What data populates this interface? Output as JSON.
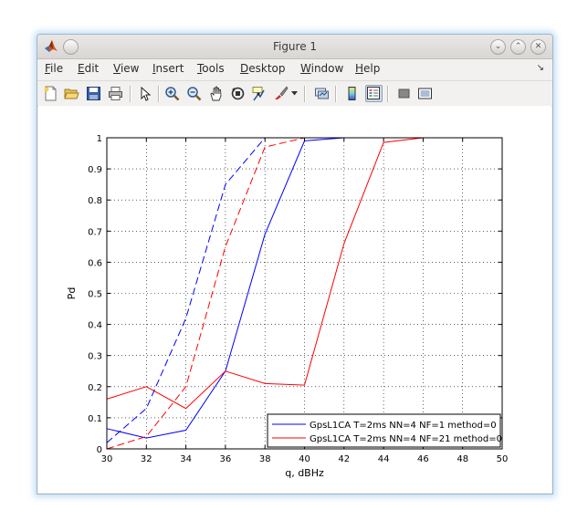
{
  "window": {
    "title": "Figure 1",
    "buttons": {
      "minimize": "⌄",
      "maximize": "⌃",
      "close": "✕"
    }
  },
  "menubar": {
    "items": [
      {
        "label": "File",
        "mnemonic": "F",
        "rest": "ile"
      },
      {
        "label": "Edit",
        "mnemonic": "E",
        "rest": "dit"
      },
      {
        "label": "View",
        "mnemonic": "V",
        "rest": "iew"
      },
      {
        "label": "Insert",
        "mnemonic": "I",
        "rest": "nsert"
      },
      {
        "label": "Tools",
        "mnemonic": "T",
        "rest": "ools"
      },
      {
        "label": "Desktop",
        "mnemonic": "D",
        "rest": "esktop"
      },
      {
        "label": "Window",
        "mnemonic": "W",
        "rest": "indow"
      },
      {
        "label": "Help",
        "mnemonic": "H",
        "rest": "elp"
      }
    ],
    "overflow_icon": "↘"
  },
  "toolbar": {
    "icons": [
      "new-figure-icon",
      "open-file-icon",
      "save-icon",
      "print-icon",
      "pointer-icon",
      "zoom-in-icon",
      "zoom-out-icon",
      "pan-icon",
      "rotate-3d-icon",
      "data-cursor-icon",
      "brush-icon",
      "link-plot-icon",
      "colorbar-icon",
      "legend-icon",
      "hide-plot-tools-icon",
      "show-plot-tools-icon"
    ]
  },
  "chart_data": {
    "type": "line",
    "xlabel": "q, dBHz",
    "ylabel": "Pd",
    "xlim": [
      30,
      50
    ],
    "ylim": [
      0,
      1
    ],
    "xticks": [
      "30",
      "32",
      "34",
      "36",
      "38",
      "40",
      "42",
      "44",
      "46",
      "48",
      "50"
    ],
    "yticks": [
      "0",
      "0.1",
      "0.2",
      "0.3",
      "0.4",
      "0.5",
      "0.6",
      "0.7",
      "0.8",
      "0.9",
      "1"
    ],
    "grid": true,
    "legend_position": "bottom-right",
    "legend": [
      {
        "label": "GpsL1CA T=2ms NN=4 NF=1 method=0",
        "color": "#0000ff"
      },
      {
        "label": "GpsL1CA T=2ms NN=4 NF=21 method=0",
        "color": "#ff0000"
      }
    ],
    "series": [
      {
        "color": "#0000ff",
        "style": "solid",
        "x": [
          30,
          32,
          34,
          36,
          38,
          40,
          42,
          44,
          46,
          48,
          50
        ],
        "y": [
          0.065,
          0.035,
          0.06,
          0.25,
          0.69,
          0.99,
          1.0,
          1.0,
          1.0,
          1.0,
          1.0
        ]
      },
      {
        "color": "#ff0000",
        "style": "solid",
        "x": [
          30,
          32,
          34,
          36,
          38,
          40,
          42,
          44,
          46,
          48,
          50
        ],
        "y": [
          0.16,
          0.2,
          0.13,
          0.25,
          0.21,
          0.205,
          0.66,
          0.985,
          1.0,
          1.0,
          1.0
        ]
      },
      {
        "color": "#0000ff",
        "style": "dashed",
        "x": [
          30,
          32,
          34,
          36,
          38,
          40,
          42,
          44,
          46,
          48,
          50
        ],
        "y": [
          0.02,
          0.13,
          0.42,
          0.85,
          1.0,
          1.0,
          1.0,
          1.0,
          1.0,
          1.0,
          1.0
        ]
      },
      {
        "color": "#ff0000",
        "style": "dashed",
        "x": [
          30,
          32,
          34,
          36,
          38,
          40,
          42,
          44,
          46,
          48,
          50
        ],
        "y": [
          0.0,
          0.04,
          0.2,
          0.65,
          0.97,
          1.0,
          1.0,
          1.0,
          1.0,
          1.0,
          1.0
        ]
      }
    ]
  }
}
